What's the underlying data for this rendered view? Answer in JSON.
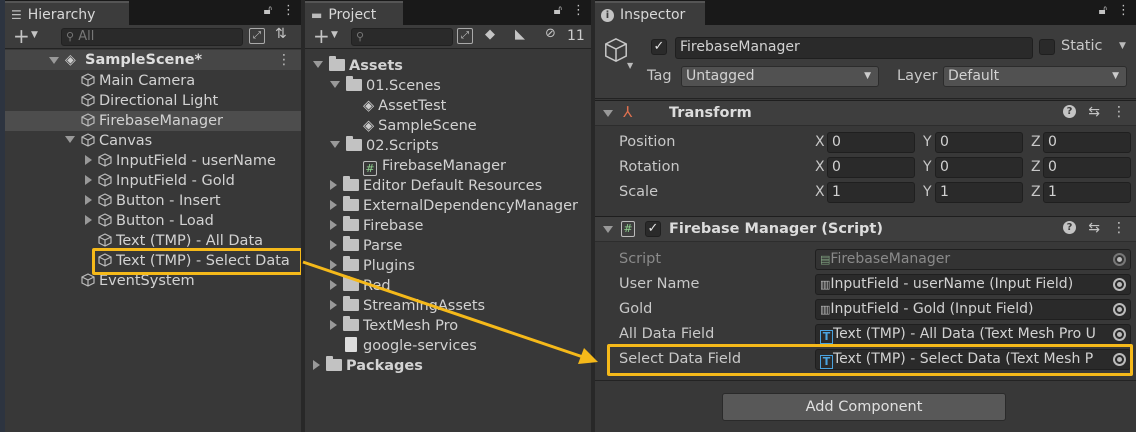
{
  "hierarchy": {
    "tab_title": "Hierarchy",
    "search_placeholder": "All",
    "scene_name": "SampleScene*",
    "items": [
      {
        "label": "Main Camera"
      },
      {
        "label": "Directional Light"
      },
      {
        "label": "FirebaseManager"
      },
      {
        "label": "Canvas"
      },
      {
        "label": "InputField - userName"
      },
      {
        "label": "InputField - Gold"
      },
      {
        "label": "Button - Insert"
      },
      {
        "label": "Button - Load"
      },
      {
        "label": "Text (TMP) - All Data"
      },
      {
        "label": "Text (TMP) - Select Data"
      },
      {
        "label": "EventSystem"
      }
    ]
  },
  "project": {
    "tab_title": "Project",
    "hidden_count": "11",
    "items": [
      {
        "label": "Assets"
      },
      {
        "label": "01.Scenes"
      },
      {
        "label": "AssetTest"
      },
      {
        "label": "SampleScene"
      },
      {
        "label": "02.Scripts"
      },
      {
        "label": "FirebaseManager"
      },
      {
        "label": "Editor Default Resources"
      },
      {
        "label": "ExternalDependencyManager"
      },
      {
        "label": "Firebase"
      },
      {
        "label": "Parse"
      },
      {
        "label": "Plugins"
      },
      {
        "label": "Red"
      },
      {
        "label": "StreamingAssets"
      },
      {
        "label": "TextMesh Pro"
      },
      {
        "label": "google-services"
      },
      {
        "label": "Packages"
      }
    ]
  },
  "inspector": {
    "tab_title": "Inspector",
    "object_name": "FirebaseManager",
    "static_label": "Static",
    "tag_label": "Tag",
    "tag_value": "Untagged",
    "layer_label": "Layer",
    "layer_value": "Default",
    "transform": {
      "title": "Transform",
      "position_label": "Position",
      "rotation_label": "Rotation",
      "scale_label": "Scale",
      "axis_x": "X",
      "axis_y": "Y",
      "axis_z": "Z",
      "position": {
        "x": "0",
        "y": "0",
        "z": "0"
      },
      "rotation": {
        "x": "0",
        "y": "0",
        "z": "0"
      },
      "scale": {
        "x": "1",
        "y": "1",
        "z": "1"
      }
    },
    "script_component": {
      "title": "Firebase Manager (Script)",
      "script_label": "Script",
      "script_value": "FirebaseManager",
      "user_name_label": "User Name",
      "user_name_value": "InputField - userName (Input Field)",
      "gold_label": "Gold",
      "gold_value": "InputField - Gold (Input Field)",
      "all_data_label": "All Data Field",
      "all_data_value": "Text (TMP) - All Data (Text Mesh Pro U",
      "select_data_label": "Select Data Field",
      "select_data_value": "Text (TMP) - Select Data (Text Mesh P"
    },
    "add_component_label": "Add Component"
  },
  "colors": {
    "highlight": "#f5b91a",
    "panel_bg": "#383838",
    "selected_row": "#4d4d4d"
  }
}
